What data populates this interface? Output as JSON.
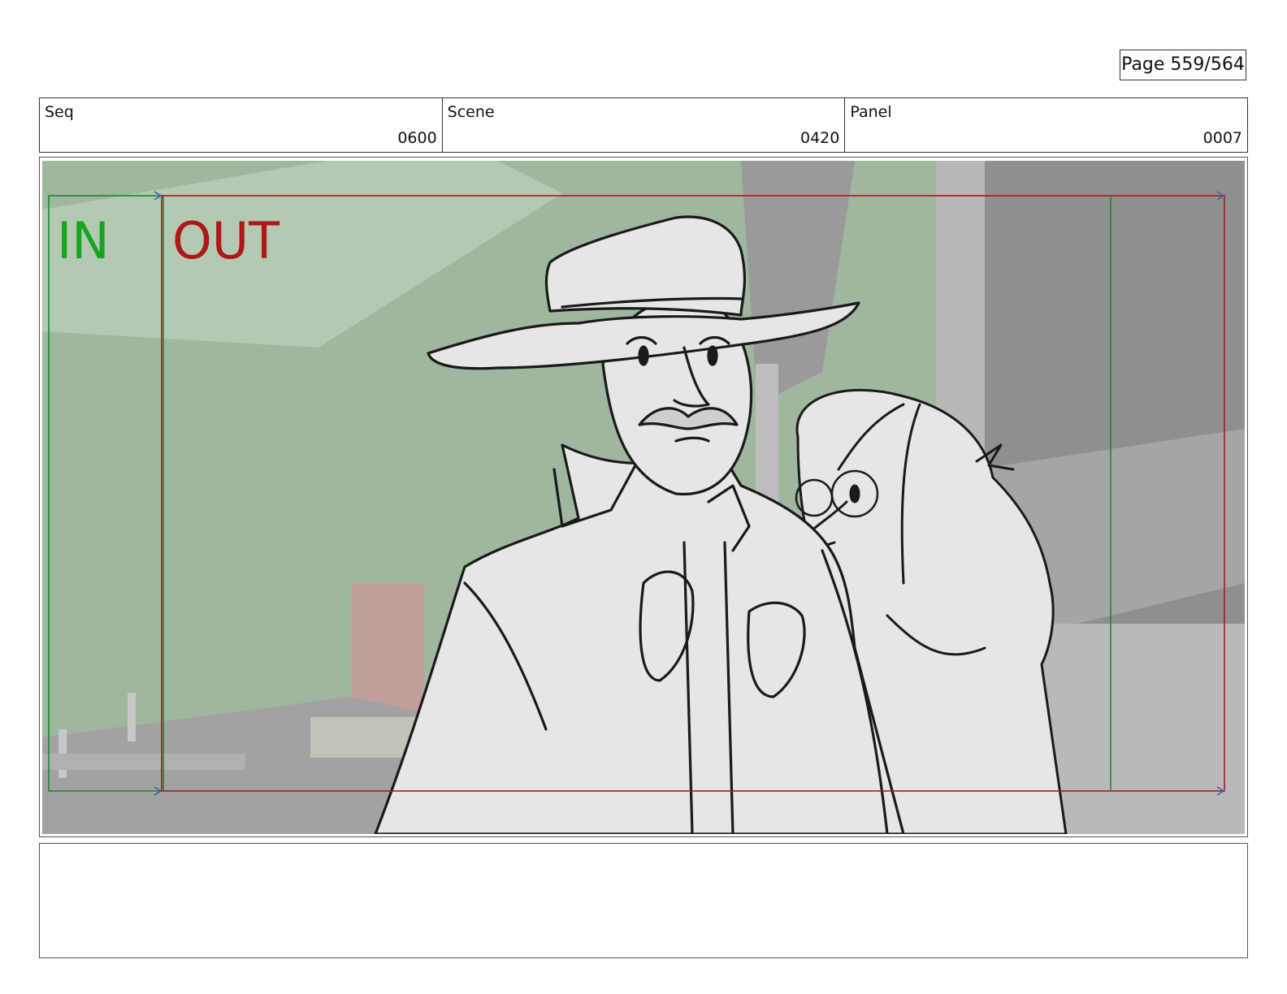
{
  "page": {
    "number_label": "Page 559/564"
  },
  "header": {
    "seq_label": "Seq",
    "seq_value": "0600",
    "scene_label": "Scene",
    "scene_value": "0420",
    "panel_label": "Panel",
    "panel_value": "0007"
  },
  "frame": {
    "in_label": "IN",
    "out_label": "OUT"
  },
  "colors": {
    "in_marker": "#1a8a2a",
    "out_marker": "#b01818",
    "background_green": "#9fb79f",
    "background_gray": "#8f8f8f",
    "sketch_fill": "#e6e6e6"
  },
  "notes": {
    "text": ""
  }
}
